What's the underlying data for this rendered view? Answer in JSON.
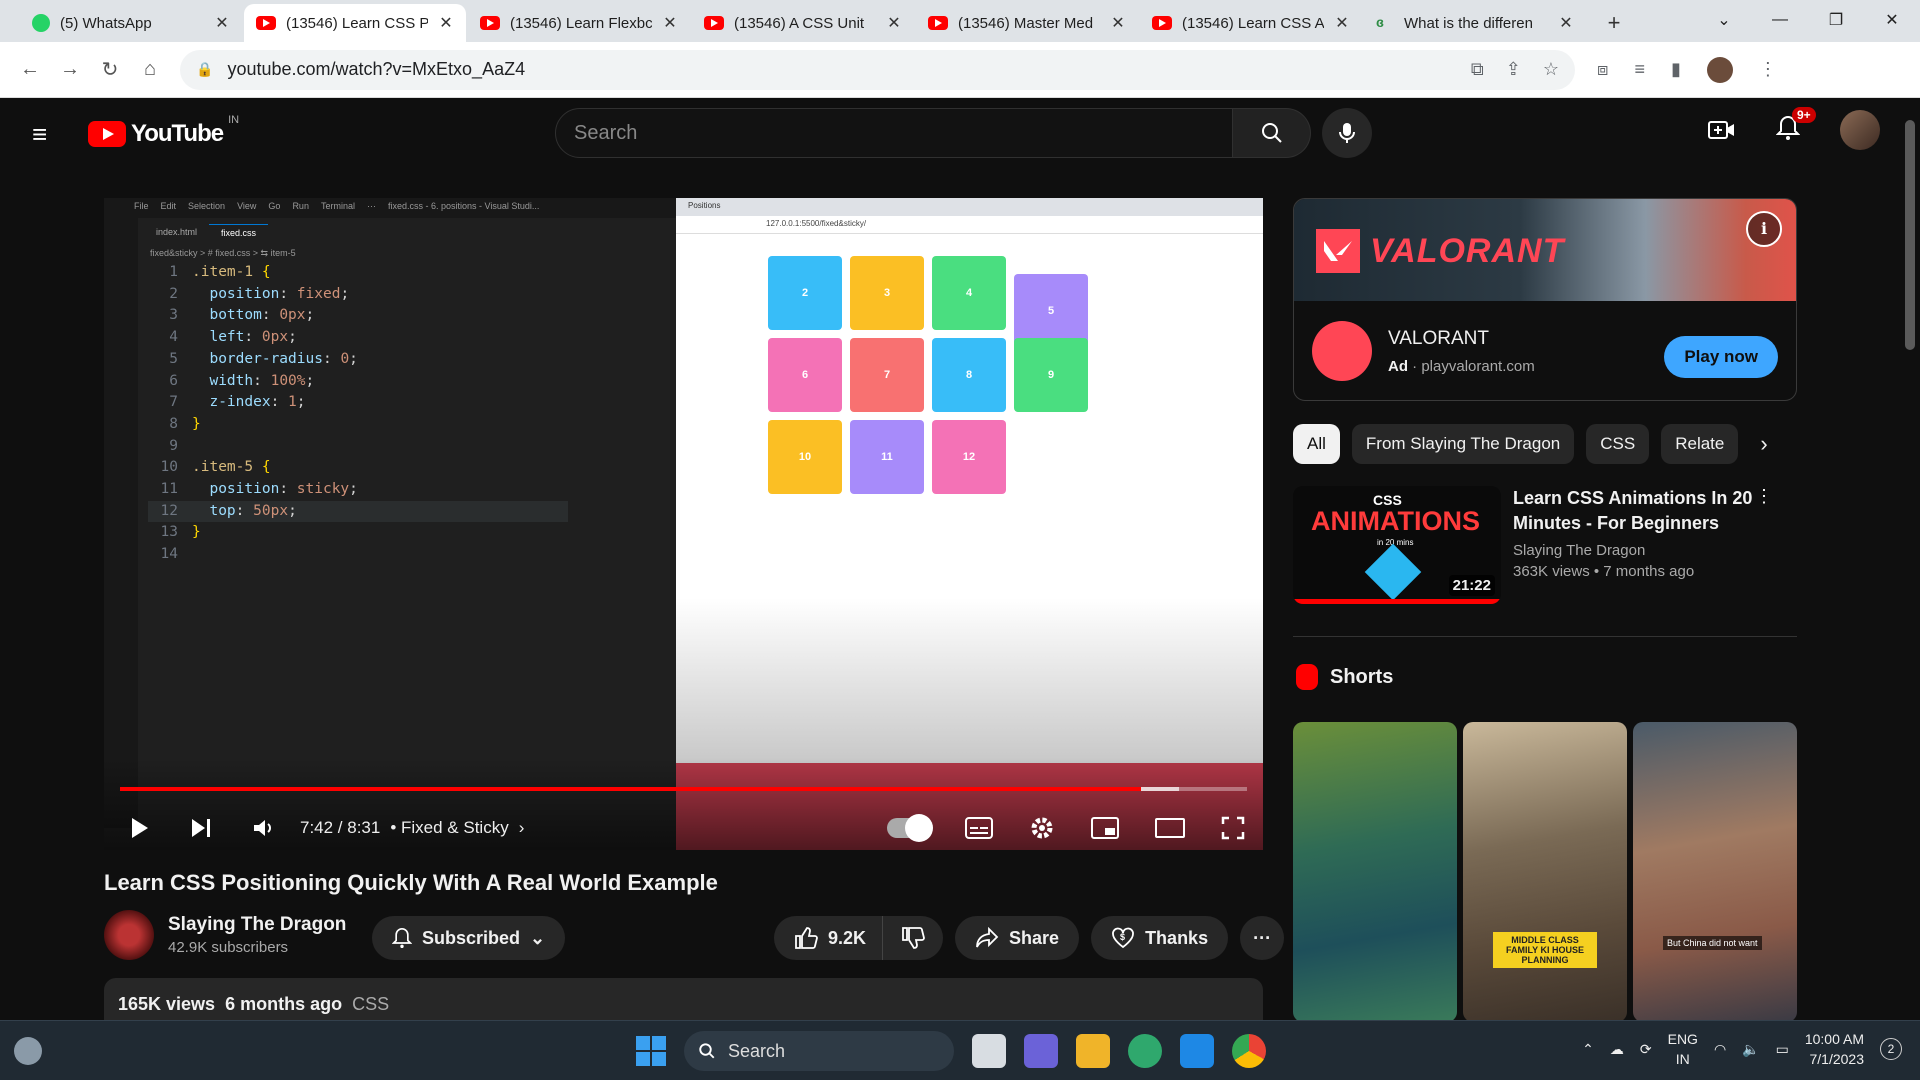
{
  "browser": {
    "tabs": [
      {
        "title": "(5) WhatsApp",
        "icon": "whatsapp-icon",
        "active": false
      },
      {
        "title": "(13546) Learn CSS P",
        "icon": "youtube-icon",
        "active": true
      },
      {
        "title": "(13546) Learn Flexbc",
        "icon": "youtube-icon",
        "active": false
      },
      {
        "title": "(13546) A CSS Unit",
        "icon": "youtube-icon",
        "active": false
      },
      {
        "title": "(13546) Master Med",
        "icon": "youtube-icon",
        "active": false
      },
      {
        "title": "(13546) Learn CSS A",
        "icon": "youtube-icon",
        "active": false
      },
      {
        "title": "What is the differen",
        "icon": "gfg-icon",
        "active": false
      }
    ],
    "url": "youtube.com/watch?v=MxEtxo_AaZ4"
  },
  "youtube": {
    "logo_text": "YouTube",
    "region": "IN",
    "search_placeholder": "Search",
    "notifications": "9+"
  },
  "video": {
    "title": "Learn CSS Positioning Quickly With A Real World Example",
    "time": "7:42 / 8:31",
    "chapter": "• Fixed & Sticky",
    "progress": 0.906,
    "buffered": 0.94,
    "channel": "Slaying The Dragon",
    "subscribers": "42.9K subscribers",
    "subscribe_label": "Subscribed",
    "likes": "9.2K",
    "share_label": "Share",
    "thanks_label": "Thanks",
    "views": "165K views",
    "age": "6 months ago",
    "tag": "CSS",
    "editor": {
      "menu": [
        "File",
        "Edit",
        "Selection",
        "View",
        "Go",
        "Run",
        "Terminal",
        "···",
        "fixed.css - 6. positions - Visual Studi..."
      ],
      "tabs": [
        "index.html",
        "fixed.css"
      ],
      "breadcrumb": "fixed&sticky > # fixed.css > ⇆ item-5",
      "lines": [
        {
          "n": "1",
          "t": ".item-1 {"
        },
        {
          "n": "2",
          "t": "  position: fixed;"
        },
        {
          "n": "3",
          "t": "  bottom: 0px;"
        },
        {
          "n": "4",
          "t": "  left: 0px;"
        },
        {
          "n": "5",
          "t": "  border-radius: 0;"
        },
        {
          "n": "6",
          "t": "  width: 100%;"
        },
        {
          "n": "7",
          "t": "  z-index: 1;"
        },
        {
          "n": "8",
          "t": "}"
        },
        {
          "n": "9",
          "t": ""
        },
        {
          "n": "10",
          "t": ".item-5 {"
        },
        {
          "n": "11",
          "t": "  position: sticky;"
        },
        {
          "n": "12",
          "t": "  top: 50px;"
        },
        {
          "n": "13",
          "t": "}"
        },
        {
          "n": "14",
          "t": ""
        }
      ]
    },
    "preview": {
      "tab": "Positions",
      "url": "127.0.0.1:5500/fixed&sticky/",
      "boxes": [
        {
          "label": "2",
          "color": "#38bdf8"
        },
        {
          "label": "3",
          "color": "#fbbf24"
        },
        {
          "label": "4",
          "color": "#4ade80"
        },
        {
          "label": "5",
          "color": "#a78bfa"
        },
        {
          "label": "6",
          "color": "#f472b6"
        },
        {
          "label": "7",
          "color": "#f87171"
        },
        {
          "label": "8",
          "color": "#38bdf8"
        },
        {
          "label": "9",
          "color": "#4ade80"
        },
        {
          "label": "10",
          "color": "#fbbf24"
        },
        {
          "label": "11",
          "color": "#a78bfa"
        },
        {
          "label": "12",
          "color": "#f472b6"
        }
      ]
    }
  },
  "ad": {
    "brand": "VALORANT",
    "name": "VALORANT",
    "ad_label": "Ad",
    "domain": "playvalorant.com",
    "cta": "Play now"
  },
  "chips": [
    "All",
    "From Slaying The Dragon",
    "CSS",
    "Relate"
  ],
  "recommendation": {
    "title": "Learn CSS Animations In 20 Minutes - For Beginners",
    "channel": "Slaying The Dragon",
    "meta": "363K views  •  7 months ago",
    "duration": "21:22",
    "thumb_top": "CSS",
    "thumb_main": "ANIMATIONS",
    "thumb_sub": "in 20 mins"
  },
  "shorts": {
    "heading": "Shorts",
    "captions": [
      "",
      "MIDDLE CLASS FAMILY KI HOUSE PLANNING",
      "But China did not want"
    ]
  },
  "taskbar": {
    "search": "Search",
    "lang1": "ENG",
    "lang2": "IN",
    "time": "10:00 AM",
    "date": "7/1/2023",
    "notifications": "2"
  },
  "colors": {
    "youtube_red": "#ff0000",
    "valorant_red": "#ff4655",
    "play_blue": "#3ea6ff"
  }
}
